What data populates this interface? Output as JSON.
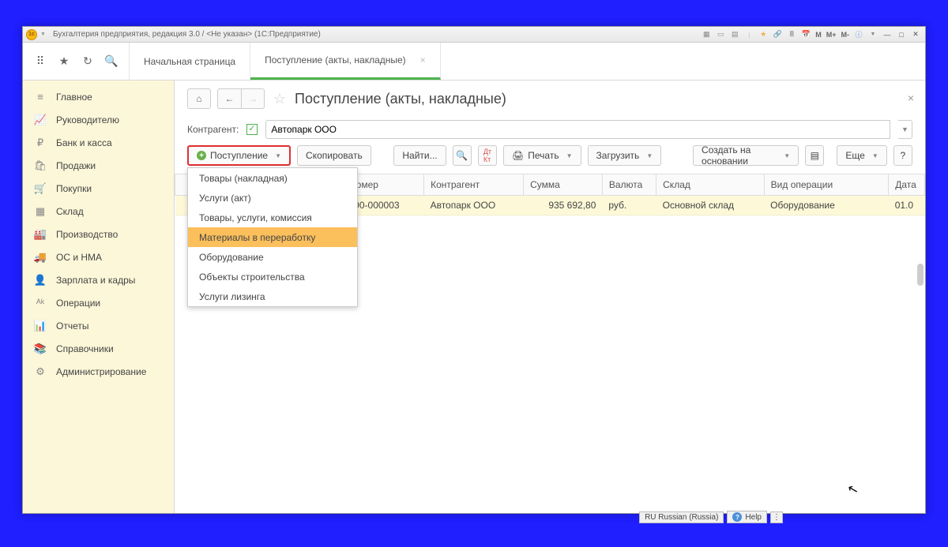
{
  "titlebar": {
    "text": "Бухгалтерия предприятия, редакция 3.0 / <Не указан>  (1С:Предприятие)",
    "m": "M",
    "mp": "M+",
    "mm": "M-"
  },
  "tabs": {
    "home": "Начальная страница",
    "active": "Поступление (акты, накладные)"
  },
  "sidebar": [
    {
      "icon": "≡",
      "label": "Главное"
    },
    {
      "icon": "📈",
      "label": "Руководителю"
    },
    {
      "icon": "₽",
      "label": "Банк и касса"
    },
    {
      "icon": "🛍",
      "label": "Продажи"
    },
    {
      "icon": "🛒",
      "label": "Покупки"
    },
    {
      "icon": "▦",
      "label": "Склад"
    },
    {
      "icon": "🏭",
      "label": "Производство"
    },
    {
      "icon": "🚚",
      "label": "ОС и НМА"
    },
    {
      "icon": "👤",
      "label": "Зарплата и кадры"
    },
    {
      "icon": "ᴬᵏ",
      "label": "Операции"
    },
    {
      "icon": "📊",
      "label": "Отчеты"
    },
    {
      "icon": "📚",
      "label": "Справочники"
    },
    {
      "icon": "⚙",
      "label": "Администрирование"
    }
  ],
  "page": {
    "title": "Поступление (акты, накладные)"
  },
  "filter": {
    "label": "Контрагент:",
    "value": "Автопарк ООО"
  },
  "toolbar": {
    "main": "Поступление",
    "copy": "Скопировать",
    "find": "Найти...",
    "print": "Печать",
    "load": "Загрузить",
    "create_on": "Создать на основании",
    "more": "Еще",
    "help": "?"
  },
  "dropdown_items": [
    "Товары (накладная)",
    "Услуги (акт)",
    "Товары, услуги, комиссия",
    "Материалы в переработку",
    "Оборудование",
    "Объекты строительства",
    "Услуги лизинга"
  ],
  "grid": {
    "headers": [
      "Номер",
      "Контрагент",
      "Сумма",
      "Валюта",
      "Склад",
      "Вид операции",
      "Дата"
    ],
    "row": {
      "number": "000-000003",
      "contragent": "Автопарк ООО",
      "sum": "935 692,80",
      "currency": "руб.",
      "warehouse": "Основной склад",
      "optype": "Оборудование",
      "date": "01.0"
    }
  },
  "status": {
    "lang": "RU Russian (Russia)",
    "help": "Help"
  }
}
